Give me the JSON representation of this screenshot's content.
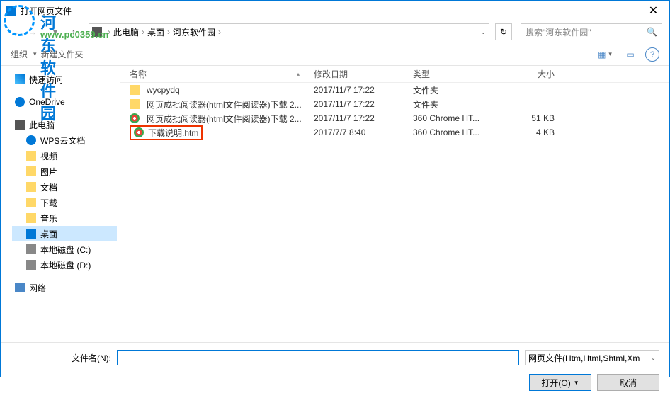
{
  "title": "打开网页文件",
  "breadcrumb": {
    "pc": "此电脑",
    "desktop": "桌面",
    "folder": "河东软件园"
  },
  "search": {
    "placeholder": "搜索\"河东软件园\""
  },
  "toolbar": {
    "organize": "组织",
    "newfolder": "新建文件夹"
  },
  "columns": {
    "name": "名称",
    "date": "修改日期",
    "type": "类型",
    "size": "大小"
  },
  "files": [
    {
      "name": "wycpydq",
      "date": "2017/11/7 17:22",
      "type": "文件夹",
      "size": "",
      "icon": "fi-folder"
    },
    {
      "name": "网页成批阅读器(html文件阅读器)下载 2...",
      "date": "2017/11/7 17:22",
      "type": "文件夹",
      "size": "",
      "icon": "fi-folder"
    },
    {
      "name": "网页成批阅读器(html文件阅读器)下载 2...",
      "date": "2017/11/7 17:22",
      "type": "360 Chrome HT...",
      "size": "51 KB",
      "icon": "fi-chrome"
    },
    {
      "name": "下载说明.htm",
      "date": "2017/7/7 8:40",
      "type": "360 Chrome HT...",
      "size": "4 KB",
      "icon": "fi-chrome",
      "highlighted": true
    }
  ],
  "sidebar": {
    "quick": "快速访问",
    "onedrive": "OneDrive",
    "pc": "此电脑",
    "items": [
      {
        "label": "WPS云文档",
        "icon": "icon-cloud"
      },
      {
        "label": "视频",
        "icon": "icon-folder"
      },
      {
        "label": "图片",
        "icon": "icon-folder"
      },
      {
        "label": "文档",
        "icon": "icon-folder"
      },
      {
        "label": "下载",
        "icon": "icon-folder"
      },
      {
        "label": "音乐",
        "icon": "icon-folder"
      },
      {
        "label": "桌面",
        "icon": "icon-desktop",
        "selected": true
      },
      {
        "label": "本地磁盘 (C:)",
        "icon": "icon-drive"
      },
      {
        "label": "本地磁盘 (D:)",
        "icon": "icon-drive"
      }
    ],
    "network": "网络"
  },
  "filename_label": "文件名(N):",
  "filetype": "网页文件(Htm,Html,Shtml,Xm",
  "open_button": "打开(O)",
  "cancel_button": "取消",
  "watermark": {
    "logo_text": "河东软件园",
    "logo_url": "www.pc0359.cn"
  }
}
